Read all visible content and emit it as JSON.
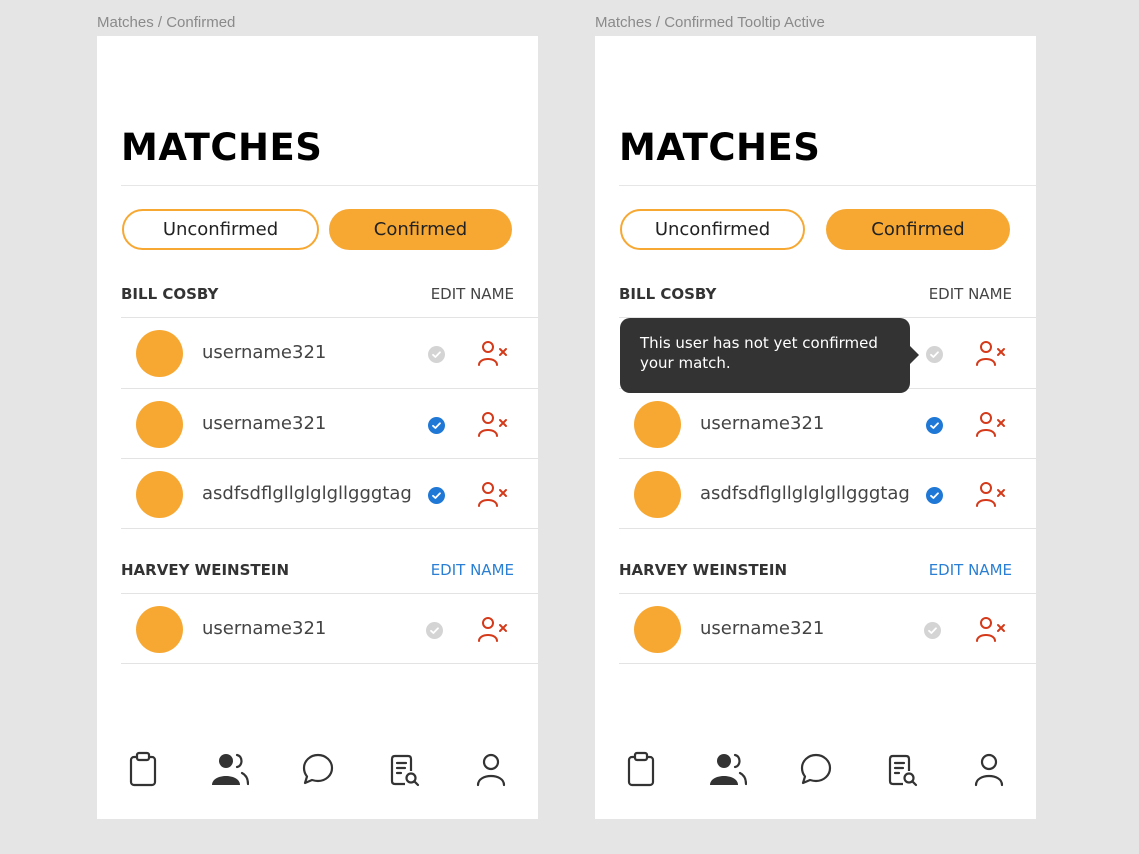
{
  "frames": [
    {
      "label": "Matches / Confirmed",
      "title": "MATCHES",
      "tabs": {
        "unconfirmed": "Unconfirmed",
        "confirmed": "Confirmed"
      },
      "groups": [
        {
          "name": "BILL COSBY",
          "edit_label": "EDIT NAME",
          "members": [
            {
              "username": "username321",
              "confirmed": false
            },
            {
              "username": "username321",
              "confirmed": true
            },
            {
              "username": "asdfsdflgllglglgllgggtag",
              "confirmed": true
            }
          ]
        },
        {
          "name": "HARVEY WEINSTEIN",
          "edit_label": "EDIT NAME",
          "members": [
            {
              "username": "username321",
              "confirmed": false
            }
          ]
        }
      ]
    },
    {
      "label": "Matches / Confirmed Tooltip Active",
      "title": "MATCHES",
      "tabs": {
        "unconfirmed": "Unconfirmed",
        "confirmed": "Confirmed"
      },
      "tooltip": "This user has not yet confirmed your match.",
      "groups": [
        {
          "name": "BILL COSBY",
          "edit_label": "EDIT NAME",
          "members": [
            {
              "username": "username321",
              "confirmed": false
            },
            {
              "username": "username321",
              "confirmed": true
            },
            {
              "username": "asdfsdflgllglglgllgggtag",
              "confirmed": true
            }
          ]
        },
        {
          "name": "HARVEY WEINSTEIN",
          "edit_label": "EDIT NAME",
          "members": [
            {
              "username": "username321",
              "confirmed": false
            }
          ]
        }
      ]
    }
  ],
  "colors": {
    "accent": "#f7a833",
    "confirmed_check": "#1f78d6",
    "unconfirmed_check": "#d4d4d4",
    "remove_icon": "#d43a1a",
    "edit_link_active": "#2a7fd4",
    "tooltip_bg": "#333333"
  },
  "icons": {
    "row_remove": "remove-user-icon",
    "tabbar": [
      "clipboard-icon",
      "users-icon",
      "chat-icon",
      "document-search-icon",
      "profile-icon"
    ]
  }
}
